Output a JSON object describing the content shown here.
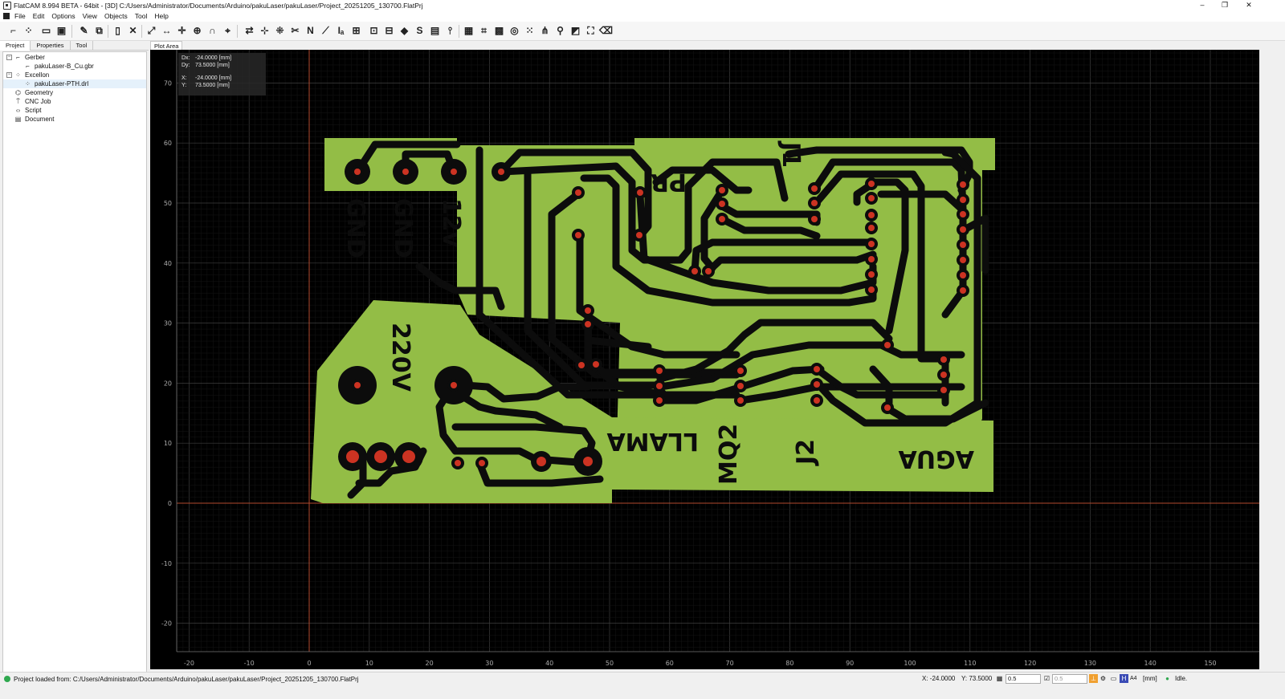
{
  "window": {
    "title": "FlatCAM 8.994 BETA - 64bit - [3D]   C:/Users/Administrator/Documents/Arduino/pakuLaser/pakuLaser/Project_20251205_130700.FlatPrj",
    "minimize": "–",
    "maximize": "❐",
    "close": "✕"
  },
  "menu": [
    "File",
    "Edit",
    "Options",
    "View",
    "Objects",
    "Tool",
    "Help"
  ],
  "toolbar_icons": [
    "new-gerber-icon",
    "new-excellon-icon",
    "open-icon",
    "save-icon",
    "edit-icon",
    "copy-icon",
    "new-doc-icon",
    "delete-icon",
    "zoom-fit-icon",
    "distance-icon",
    "origin-icon",
    "center-icon",
    "snap-icon",
    "locate-icon",
    "flip-icon",
    "align-icon",
    "move-icon",
    "cutout-icon",
    "n-icon",
    "line-icon",
    "font-icon",
    "grid-icon",
    "pad-icon",
    "panel-icon",
    "paint-icon",
    "solder-icon",
    "film-icon",
    "ruler-icon",
    "calc-icon",
    "crop-icon",
    "qr-icon",
    "optimal-icon",
    "dots-icon",
    "copper-icon",
    "fiducial-icon",
    "invert-icon",
    "corners-icon",
    "erase-icon"
  ],
  "left_tabs": [
    "Project",
    "Properties",
    "Tool"
  ],
  "tree": [
    {
      "label": "Gerber",
      "level": 0,
      "expander": "−",
      "icon": "gerber-icon"
    },
    {
      "label": "pakuLaser-B_Cu.gbr",
      "level": 1,
      "expander": "",
      "icon": "gerber-file-icon"
    },
    {
      "label": "Excellon",
      "level": 0,
      "expander": "−",
      "icon": "excellon-icon"
    },
    {
      "label": "pakuLaser-PTH.drl",
      "level": 1,
      "expander": "",
      "icon": "excellon-file-icon",
      "selected": true
    },
    {
      "label": "Geometry",
      "level": 0,
      "expander": "",
      "icon": "geometry-icon"
    },
    {
      "label": "CNC Job",
      "level": 0,
      "expander": "",
      "icon": "cnc-icon"
    },
    {
      "label": "Script",
      "level": 0,
      "expander": "",
      "icon": "script-icon"
    },
    {
      "label": "Document",
      "level": 0,
      "expander": "",
      "icon": "document-icon"
    }
  ],
  "plot_tab": "Plot Area",
  "coords": {
    "dx_label": "Dx:",
    "dx": "-24.0000 [mm]",
    "dy_label": "Dy:",
    "dy": "73.5000 [mm]",
    "x_label": "X:",
    "x": "-24.0000 [mm]",
    "y_label": "Y:",
    "y": "73.5000 [mm]"
  },
  "axis": {
    "x_ticks": [
      "-20",
      "-10",
      "0",
      "10",
      "20",
      "30",
      "40",
      "50",
      "60",
      "70",
      "80",
      "90",
      "100",
      "110",
      "120",
      "130",
      "140",
      "150"
    ],
    "y_ticks": [
      "70",
      "60",
      "50",
      "40",
      "30",
      "20",
      "10",
      "0",
      "-10",
      "-20"
    ]
  },
  "pcb_labels": [
    "GND",
    "GND",
    "12v",
    "220V",
    "PR",
    "J1",
    "LLAMA",
    "MQ2",
    "J2",
    "AGUA"
  ],
  "colors": {
    "copper": "#93bd46",
    "trace": "#0c0c0c",
    "drill": "#cc3322",
    "grid": "#3a3a3a",
    "axis": "#b24a2e"
  },
  "status": {
    "message": "Project loaded from: C:/Users/Administrator/Documents/Arduino/pakuLaser/pakuLaser/Project_20251205_130700.FlatPrj",
    "x": "X: -24.0000",
    "y": "Y: 73.5000",
    "grid_x": "0.5",
    "grid_y": "0.5",
    "paper": "A4",
    "units": "[mm]",
    "state": "Idle."
  }
}
